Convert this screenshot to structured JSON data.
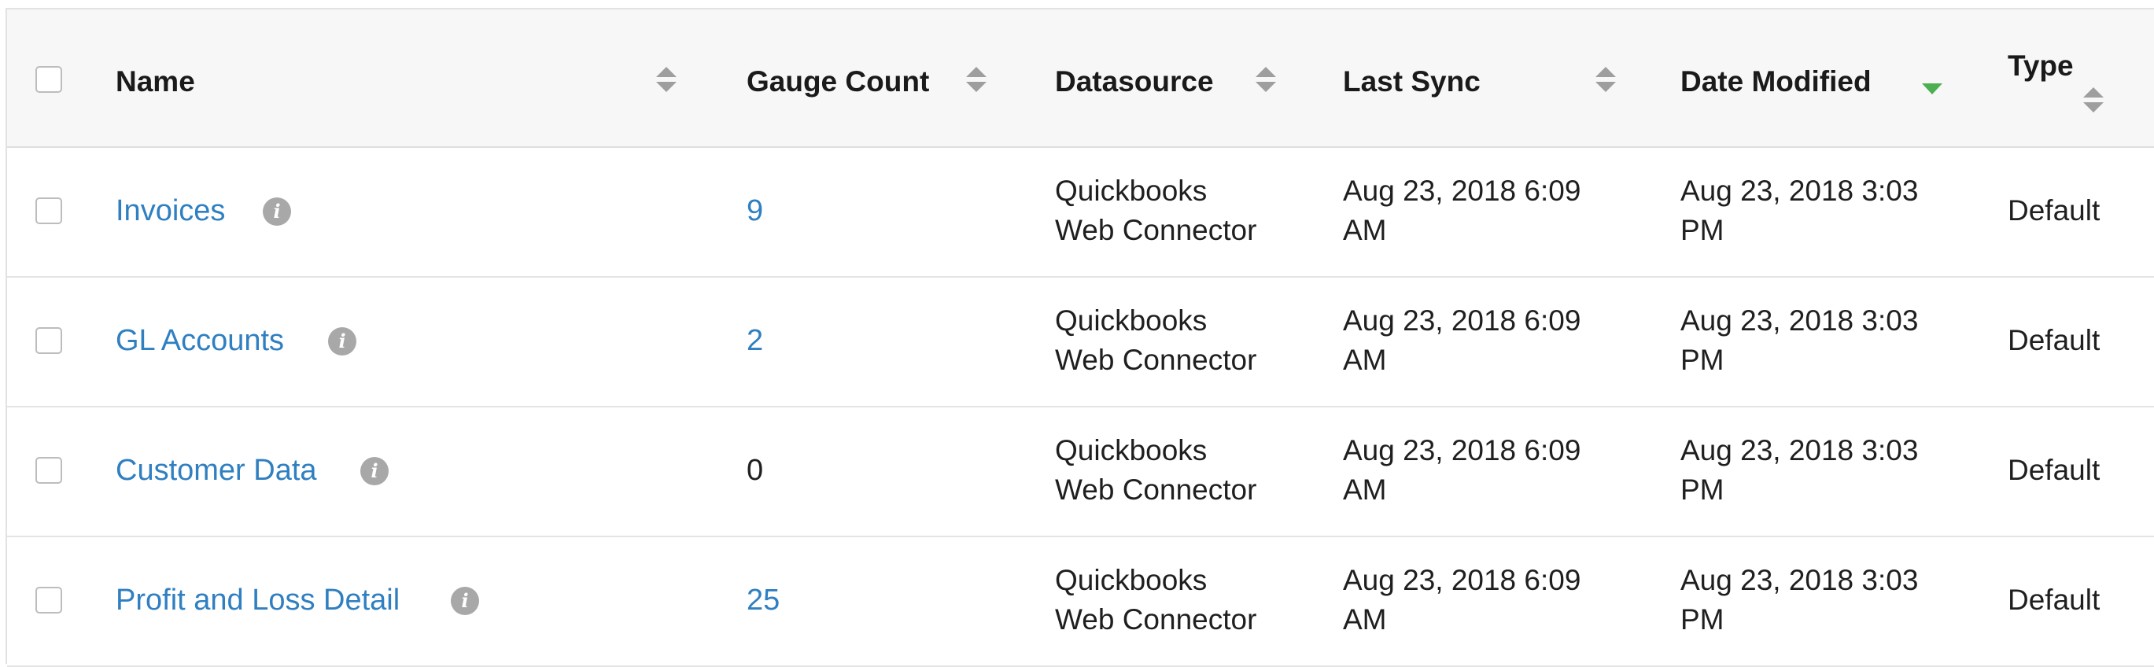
{
  "table": {
    "columns": {
      "name": "Name",
      "gauge_count": "Gauge Count",
      "datasource": "Datasource",
      "last_sync": "Last Sync",
      "date_modified": "Date Modified",
      "type": "Type"
    },
    "sorted_by": "date_modified",
    "sort_direction": "descending",
    "accent_color": "#4caf50",
    "link_color": "#2f7fc1",
    "rows": [
      {
        "name": "Invoices",
        "gauge_count": "9",
        "gauge_count_is_link": true,
        "datasource_line1": "Quickbooks",
        "datasource_line2": "Web Connector",
        "last_sync_line1": "Aug 23, 2018 6:09",
        "last_sync_line2": "AM",
        "date_modified_line1": "Aug 23, 2018 3:03",
        "date_modified_line2": "PM",
        "type": "Default"
      },
      {
        "name": "GL Accounts",
        "gauge_count": "2",
        "gauge_count_is_link": true,
        "datasource_line1": "Quickbooks",
        "datasource_line2": "Web Connector",
        "last_sync_line1": "Aug 23, 2018 6:09",
        "last_sync_line2": "AM",
        "date_modified_line1": "Aug 23, 2018 3:03",
        "date_modified_line2": "PM",
        "type": "Default"
      },
      {
        "name": "Customer Data",
        "gauge_count": "0",
        "gauge_count_is_link": false,
        "datasource_line1": "Quickbooks",
        "datasource_line2": "Web Connector",
        "last_sync_line1": "Aug 23, 2018 6:09",
        "last_sync_line2": "AM",
        "date_modified_line1": "Aug 23, 2018 3:03",
        "date_modified_line2": "PM",
        "type": "Default"
      },
      {
        "name": "Profit and Loss Detail",
        "gauge_count": "25",
        "gauge_count_is_link": true,
        "datasource_line1": "Quickbooks",
        "datasource_line2": "Web Connector",
        "last_sync_line1": "Aug 23, 2018 6:09",
        "last_sync_line2": "AM",
        "date_modified_line1": "Aug 23, 2018 3:03",
        "date_modified_line2": "PM",
        "type": "Default"
      }
    ],
    "icons": {
      "info": "info-icon",
      "sort": "sort-icon",
      "sort_active": "sort-descending-icon"
    }
  }
}
